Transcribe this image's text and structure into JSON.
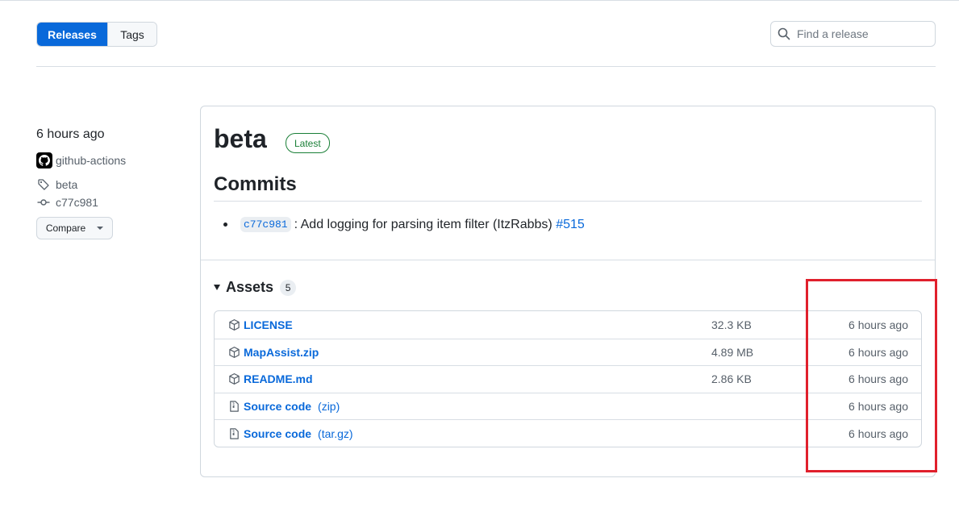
{
  "nav": {
    "releases_label": "Releases",
    "tags_label": "Tags",
    "search_placeholder": "Find a release"
  },
  "meta": {
    "time": "6 hours ago",
    "author": "github-actions",
    "tag": "beta",
    "commit": "c77c981",
    "compare_label": "Compare"
  },
  "release": {
    "title": "beta",
    "badge": "Latest",
    "commits_heading": "Commits",
    "commits": [
      {
        "sha": "c77c981",
        "message": ": Add logging for parsing item filter (ItzRabbs) ",
        "pr": "#515"
      }
    ]
  },
  "assets": {
    "heading": "Assets",
    "count": "5",
    "items": [
      {
        "name": "LICENSE",
        "ext": "",
        "size": "32.3 KB",
        "time": "6 hours ago",
        "icon": "package-icon"
      },
      {
        "name": "MapAssist.zip",
        "ext": "",
        "size": "4.89 MB",
        "time": "6 hours ago",
        "icon": "package-icon"
      },
      {
        "name": "README.md",
        "ext": "",
        "size": "2.86 KB",
        "time": "6 hours ago",
        "icon": "package-icon"
      },
      {
        "name": "Source code",
        "ext": "(zip)",
        "size": "",
        "time": "6 hours ago",
        "icon": "file-zip-icon"
      },
      {
        "name": "Source code",
        "ext": "(tar.gz)",
        "size": "",
        "time": "6 hours ago",
        "icon": "file-zip-icon"
      }
    ]
  },
  "colors": {
    "accent": "#0969da",
    "latest_green": "#1a7f37",
    "highlight_red": "#e0202c"
  }
}
